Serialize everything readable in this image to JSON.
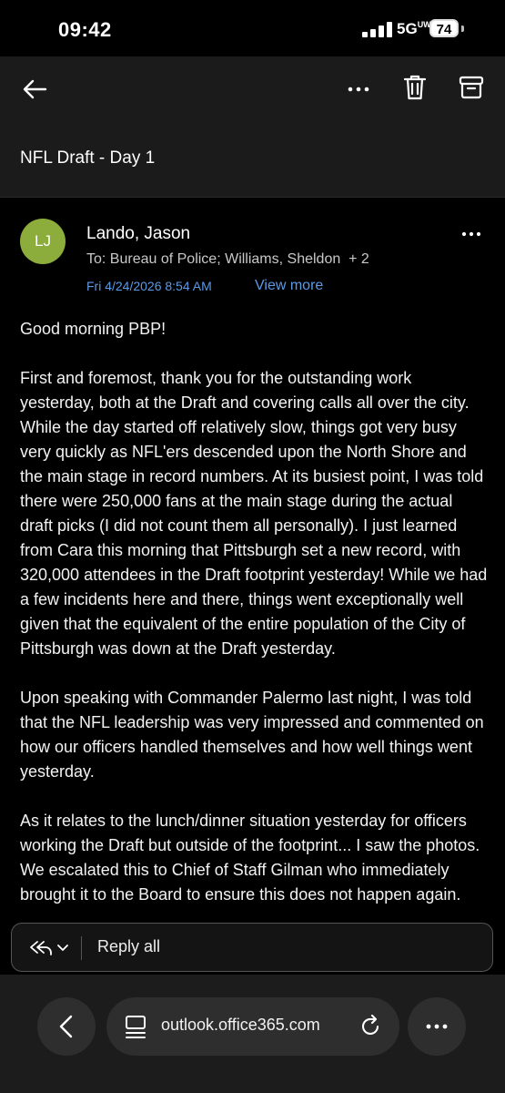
{
  "status_bar": {
    "time": "09:42",
    "network": "5G",
    "network_sub": "UW",
    "battery": "74"
  },
  "subject": "NFL Draft - Day 1",
  "email": {
    "avatar_initials": "LJ",
    "sender": "Lando, Jason",
    "recipients": "To: Bureau of Police;  Williams, Sheldon",
    "extra_recipients": "+ 2",
    "date": "Fri 4/24/2026 8:54 AM",
    "view_more": "View more",
    "paragraphs": [
      "Good morning PBP!",
      "First and foremost, thank you for the outstanding work yesterday, both at the Draft and covering calls all over the city. While the day started off relatively slow, things got very busy very quickly as NFL'ers descended upon the North Shore and the main stage in record numbers. At its busiest point, I was told there were 250,000 fans at the main stage during the actual draft picks (I did not count them all personally). I just learned from Cara this morning that Pittsburgh set a new record, with 320,000 attendees in the Draft footprint yesterday! While we had a few incidents here and there, things went exceptionally well given that the equivalent of the entire population of the City of Pittsburgh was down at the Draft yesterday.",
      "Upon speaking with Commander Palermo last night, I was told that the NFL leadership was very impressed and commented on how our officers handled themselves and how well things went yesterday.",
      "As it relates to the lunch/dinner situation yesterday for officers working the Draft but outside of the footprint... I saw the photos. We escalated this to Chief of Staff Gilman who immediately brought it to the Board to ensure this does not happen again."
    ]
  },
  "reply": {
    "label": "Reply all"
  },
  "browser": {
    "url": "outlook.office365.com"
  },
  "colors": {
    "accent": "#5a9ae6",
    "avatar": "#8cad3b",
    "bar": "#1b1b1b"
  }
}
